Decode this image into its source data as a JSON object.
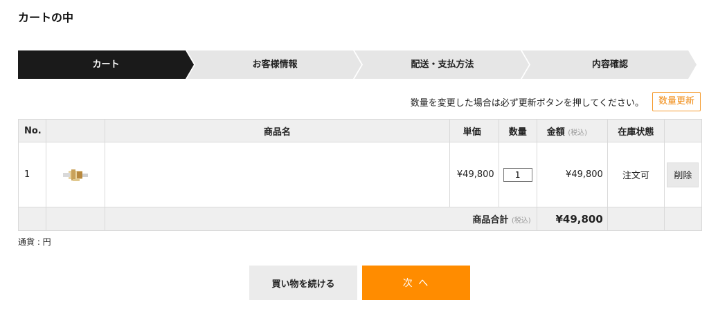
{
  "page": {
    "title": "カートの中"
  },
  "steps": [
    {
      "label": "カート",
      "active": true
    },
    {
      "label": "お客様情報",
      "active": false
    },
    {
      "label": "配送・支払方法",
      "active": false
    },
    {
      "label": "内容確認",
      "active": false
    }
  ],
  "update": {
    "note": "数量を変更した場合は必ず更新ボタンを押してください。",
    "button_label": "数量更新"
  },
  "table": {
    "headers": {
      "no": "No.",
      "image": "",
      "name": "商品名",
      "price": "単価",
      "qty": "数量",
      "amount": "金額",
      "amount_tax": "(税込)",
      "stock": "在庫状態",
      "delete": ""
    },
    "rows": [
      {
        "no": "1",
        "name": "",
        "price": "¥49,800",
        "qty": "1",
        "amount": "¥49,800",
        "stock": "注文可",
        "delete_label": "削除"
      }
    ],
    "footer": {
      "label": "商品合計",
      "tax": "(税込)",
      "total": "¥49,800"
    }
  },
  "currency_note": "通貨 : 円",
  "buttons": {
    "continue_label": "買い物を続ける",
    "next_label": "次 へ"
  },
  "colors": {
    "step_active": "#1a1a1a",
    "step_inactive": "#e6e6e6",
    "accent": "#ff8c00",
    "header_bg": "#efefef"
  }
}
